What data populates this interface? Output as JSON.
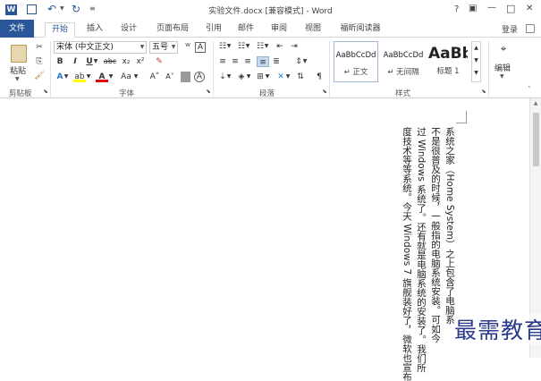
{
  "titlebar": {
    "title": "实验文件.docx [兼容模式] - Word",
    "help": "?",
    "restore": "▣",
    "minimize": "—",
    "maximize": "□",
    "close": "✕"
  },
  "tabs": [
    {
      "label": "文件"
    },
    {
      "label": "开始"
    },
    {
      "label": "插入"
    },
    {
      "label": "设计"
    },
    {
      "label": "页面布局"
    },
    {
      "label": "引用"
    },
    {
      "label": "邮件"
    },
    {
      "label": "审阅"
    },
    {
      "label": "视图"
    },
    {
      "label": "福昕阅读器"
    }
  ],
  "account": {
    "login": "登录"
  },
  "ribbon": {
    "clipboard": {
      "paste": "粘贴",
      "group": "剪贴板"
    },
    "font": {
      "name": "宋体 (中文正文)",
      "size": "五号",
      "group": "字体",
      "bold": "B",
      "italic": "I",
      "underline": "U",
      "strike": "abc",
      "subscript": "x₂",
      "superscript": "x²",
      "grow": "A˄",
      "shrink": "A˅",
      "case": "Aa",
      "clear": "A"
    },
    "paragraph": {
      "group": "段落"
    },
    "styles": {
      "group": "样式",
      "items": [
        {
          "sample": "AaBbCcDd",
          "name": "↵ 正文"
        },
        {
          "sample": "AaBbCcDd",
          "name": "↵ 无间隔"
        },
        {
          "sample": "AaBb",
          "name": "标题 1"
        }
      ]
    },
    "editing": {
      "label": "编辑"
    }
  },
  "document": {
    "lines": [
      "系统之家（Home System）之上包含了电脑系",
      "不是很普及的时候，一般指的电脑系统安装。可如今",
      "过 Windows 系统了。还有就是电脑系统的安装了。我们所",
      "度技术等等系统。今天 Windows 7 旗舰装好了，微软也宣布"
    ]
  },
  "watermark": {
    "text": "最需教育"
  },
  "colors": {
    "file_tab": "#2b579a",
    "accent": "#2b579a",
    "watermark": "#2b3a8a"
  }
}
